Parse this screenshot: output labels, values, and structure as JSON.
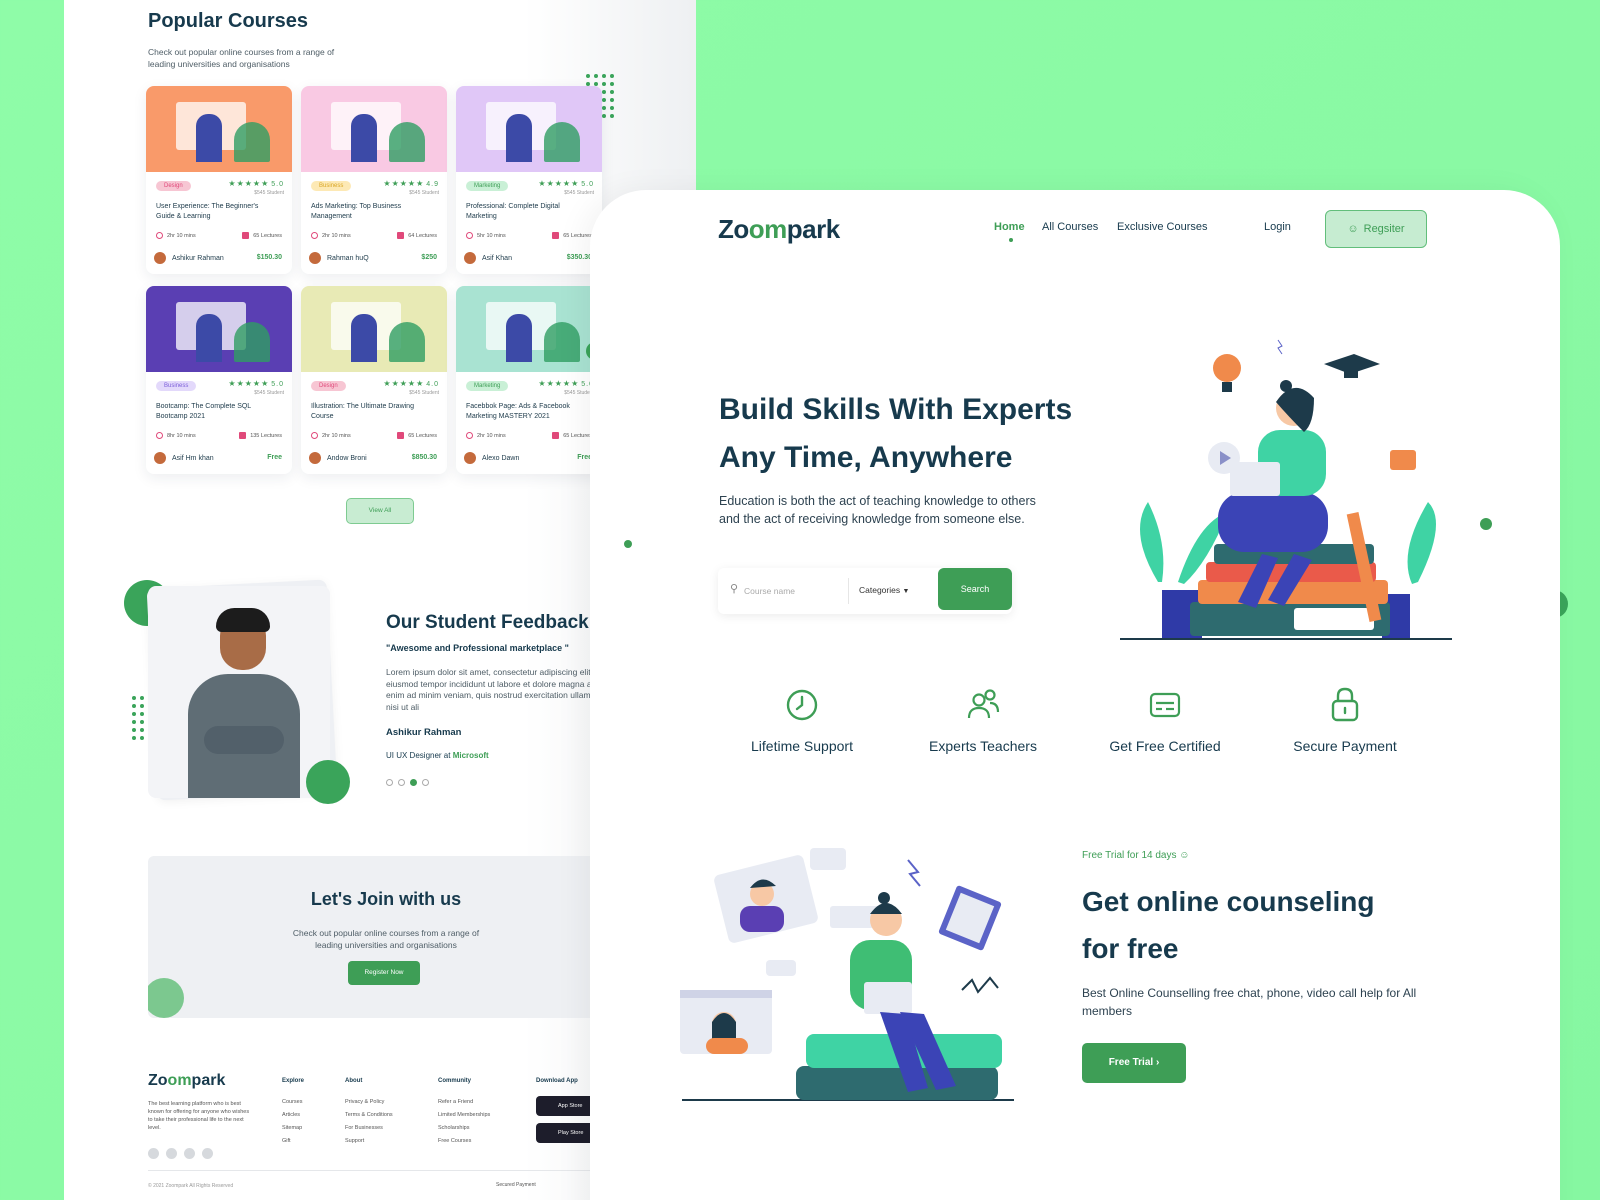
{
  "back": {
    "popular": {
      "title": "Popular Courses",
      "subtitle": "Check out popular online courses from a range of leading universities and organisations"
    },
    "courses": [
      {
        "tag": "Design",
        "rating": "5.0",
        "students": "$545 Student",
        "title": "User Experience: The Beginner's Guide & Learning",
        "duration": "2hr 10 mins",
        "lectures": "65 Lectures",
        "author": "Ashikur Rahman",
        "price": "$150.30",
        "tag_color": "#f7c6d3",
        "tag_text": "#e0497a",
        "img_color": "#f99a6a"
      },
      {
        "tag": "Business",
        "rating": "4.9",
        "students": "$545 Student",
        "title": "Ads Marketing: Top Business Management",
        "duration": "2hr 10 mins",
        "lectures": "64 Lectures",
        "author": "Rahman huQ",
        "price": "$250",
        "tag_color": "#fde9b5",
        "tag_text": "#d9a625",
        "img_color": "#f9c9e3"
      },
      {
        "tag": "Marketing",
        "rating": "5.0",
        "students": "$545 Student",
        "title": "Professional: Complete Digital Marketing",
        "duration": "5hr 10 mins",
        "lectures": "65 Lectures",
        "author": "Asif Khan",
        "price": "$350.30",
        "tag_color": "#c9f0d6",
        "tag_text": "#3e9e56",
        "img_color": "#e0c7f7"
      },
      {
        "tag": "Business",
        "rating": "5.0",
        "students": "$545 Student",
        "title": "Bootcamp: The Complete SQL Bootcamp 2021",
        "duration": "8hr 10 mins",
        "lectures": "135 Lectures",
        "author": "Asif Hm khan",
        "price": "Free",
        "tag_color": "#e3d9fb",
        "tag_text": "#7b5ed9",
        "img_color": "#5a3fb3"
      },
      {
        "tag": "Design",
        "rating": "4.0",
        "students": "$545 Student",
        "title": "Illustration: The Ultimate Drawing Course",
        "duration": "2hr 10 mins",
        "lectures": "65 Lectures",
        "author": "Andow Broni",
        "price": "$850.30",
        "tag_color": "#f7c6d3",
        "tag_text": "#e0497a",
        "img_color": "#e8eab5"
      },
      {
        "tag": "Marketing",
        "rating": "5.0",
        "students": "$545 Student",
        "title": "Facebbok Page: Ads & Facebook Marketing MASTERY 2021",
        "duration": "2hr 10 mins",
        "lectures": "65 Lectures",
        "author": "Alexo Dawn",
        "price": "Free",
        "tag_color": "#c9f0d6",
        "tag_text": "#3e9e56",
        "img_color": "#a9e3d2"
      }
    ],
    "view_all": "View All",
    "feedback": {
      "title": "Our Student Feedback",
      "quote": "\"Awesome and Professional marketplace \"",
      "text": "Lorem ipsum dolor sit amet, consectetur adipiscing elit, sed do eiusmod tempor incididunt ut labore et dolore magna aliqua. Ut enim ad minim veniam, quis nostrud exercitation ullamco laboris nisi ut ali",
      "name": "Ashikur Rahman",
      "role": "UI UX Designer at",
      "company": "Microsoft"
    },
    "join": {
      "title": "Let's Join with us",
      "subtitle": "Check out popular online courses from a range of leading universities and organisations",
      "button": "Register Now"
    },
    "footer": {
      "logo_a": "Zo",
      "logo_b": "om",
      "logo_c": "park",
      "desc": "The best learning platform who is best known for offering for anyone who wishes to take their professional life to the next level.",
      "explore": {
        "title": "Explore",
        "items": [
          "Courses",
          "Articles",
          "Sitemap",
          "Gift"
        ]
      },
      "about": {
        "title": "About",
        "items": [
          "Privacy & Policy",
          "Terms & Conditions",
          "For Businesses",
          "Support"
        ]
      },
      "community": {
        "title": "Community",
        "items": [
          "Refer a Friend",
          "Limited Memberships",
          "Scholarships",
          "Free Courses"
        ]
      },
      "download": {
        "title": "Download App",
        "app_store": "App Store",
        "play_store": "Play Store"
      },
      "copyright": "© 2021 Zoompark All Rights Reserved",
      "secured": "Secured Payment"
    }
  },
  "front": {
    "logo_a": "Zo",
    "logo_b": "om",
    "logo_c": "park",
    "nav": {
      "home": "Home",
      "all_courses": "All Courses",
      "exclusive": "Exclusive Courses",
      "login": "Login",
      "register": "Regsiter"
    },
    "hero": {
      "title_line1": "Build Skills With Experts",
      "title_line2": "Any Time, Anywhere",
      "subtitle": "Education is both the act of teaching knowledge to others and the act of receiving knowledge from someone else.",
      "search_placeholder": "Course name",
      "categories": "Categories",
      "search_button": "Search"
    },
    "features": [
      {
        "label": "Lifetime Support",
        "icon": "clock-icon"
      },
      {
        "label": "Experts Teachers",
        "icon": "users-icon"
      },
      {
        "label": "Get Free Certified",
        "icon": "certificate-icon"
      },
      {
        "label": "Secure Payment",
        "icon": "lock-icon"
      }
    ],
    "trial": {
      "tag": "Free Trial for 14 days",
      "title_line1": "Get online counseling",
      "title_line2": "for free",
      "subtitle": "Best Online Counselling free chat, phone, video call help for All members",
      "button": "Free Trial"
    }
  },
  "colors": {
    "brand": "#3e9e56",
    "dark": "#173a4d",
    "background": "#8ffca8"
  }
}
